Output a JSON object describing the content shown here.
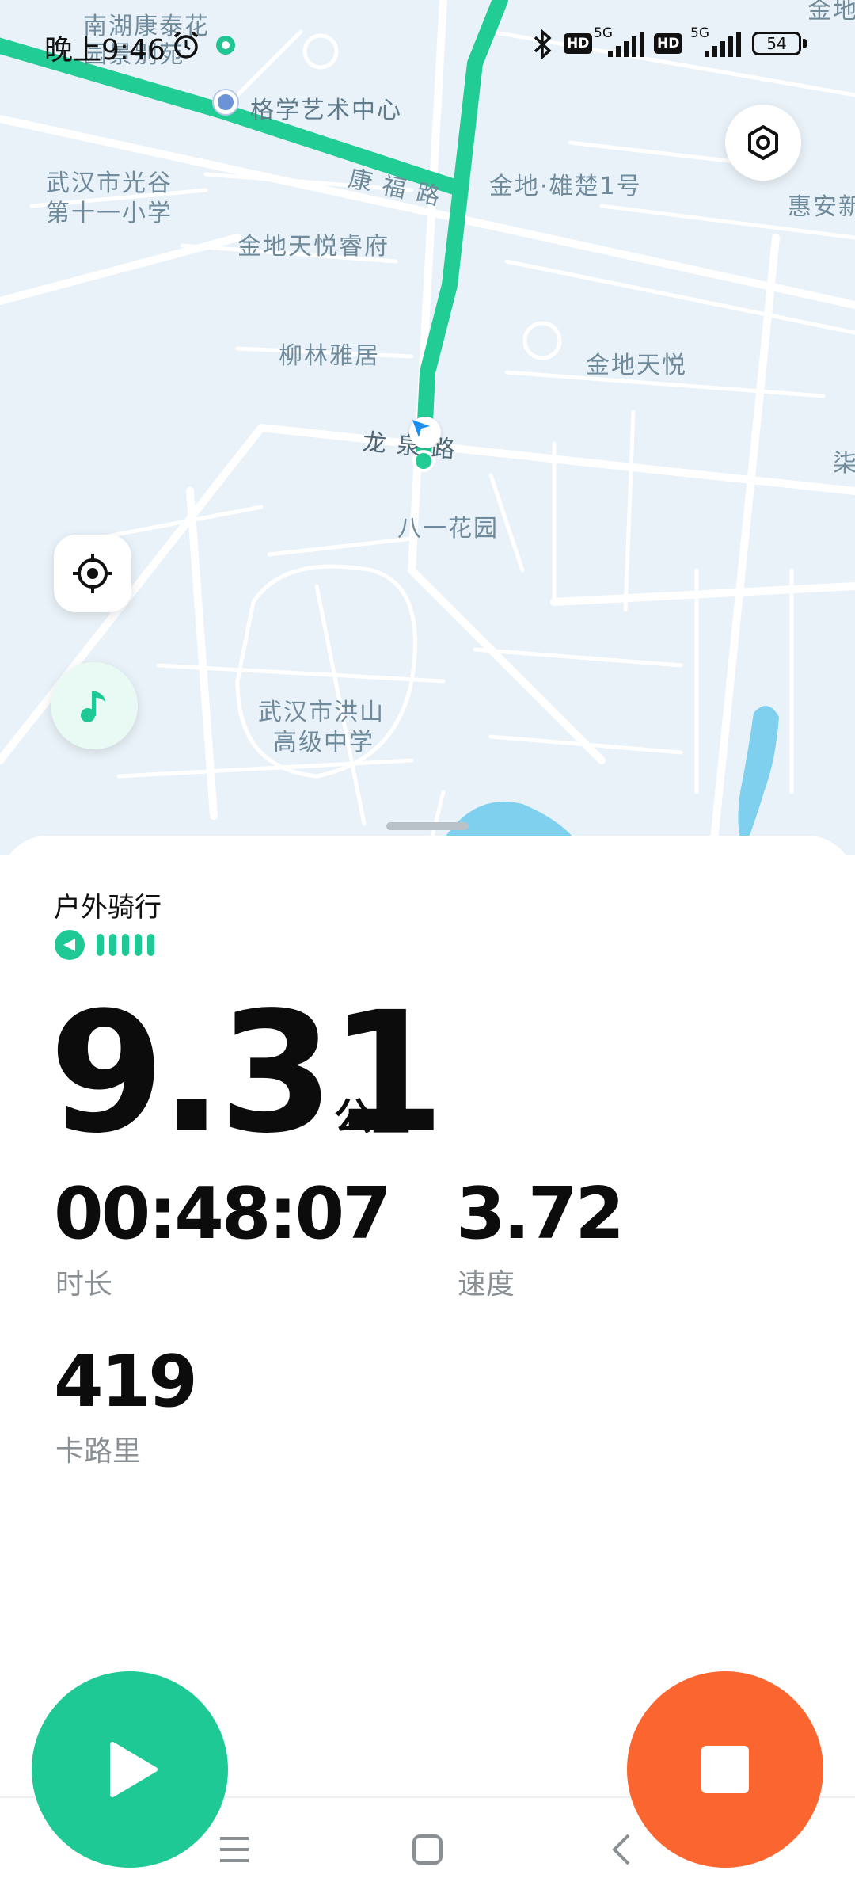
{
  "status_bar": {
    "time": "晚上9:46",
    "battery": "54",
    "hd_badge": "HD",
    "network_1": "5G",
    "network_2": "5G",
    "icons": [
      "alarm-icon",
      "bluetooth-icon",
      "signal-icon",
      "battery-icon"
    ]
  },
  "map": {
    "labels": {
      "nanhu": "南湖康泰花",
      "nanhu2": "园景别苑",
      "gexue": "格学艺术中心",
      "school1_line1": "武汉市光谷",
      "school1_line2": "第十一小学",
      "kangfu": "康 福 路",
      "jindi_xiongchu": "金地·雄楚1号",
      "huian": "惠安新",
      "jindi_tianyue_ruifu": "金地天悦睿府",
      "liulin": "柳林雅居",
      "jindi_tianyue": "金地天悦",
      "longquan": "龙 泉 路",
      "bayi": "八一花园",
      "school2_line1": "武汉市洪山",
      "school2_line2": "高级中学",
      "zuo_edge": "柒",
      "top_right": "金地"
    },
    "route_color": "#22cc95",
    "location_marker_color": "#1a9bf0"
  },
  "workout": {
    "sport_title": "户外骑行",
    "distance": "9.31",
    "distance_unit": "公里",
    "duration": "00:48:07",
    "duration_label": "时长",
    "speed": "3.72",
    "speed_label": "速度",
    "calories": "419",
    "calories_label": "卡路里",
    "gps_signal_bars": 5
  },
  "colors": {
    "accent_green": "#1fc995",
    "stop_orange": "#fa6530",
    "map_bg": "#e9f2f8"
  }
}
